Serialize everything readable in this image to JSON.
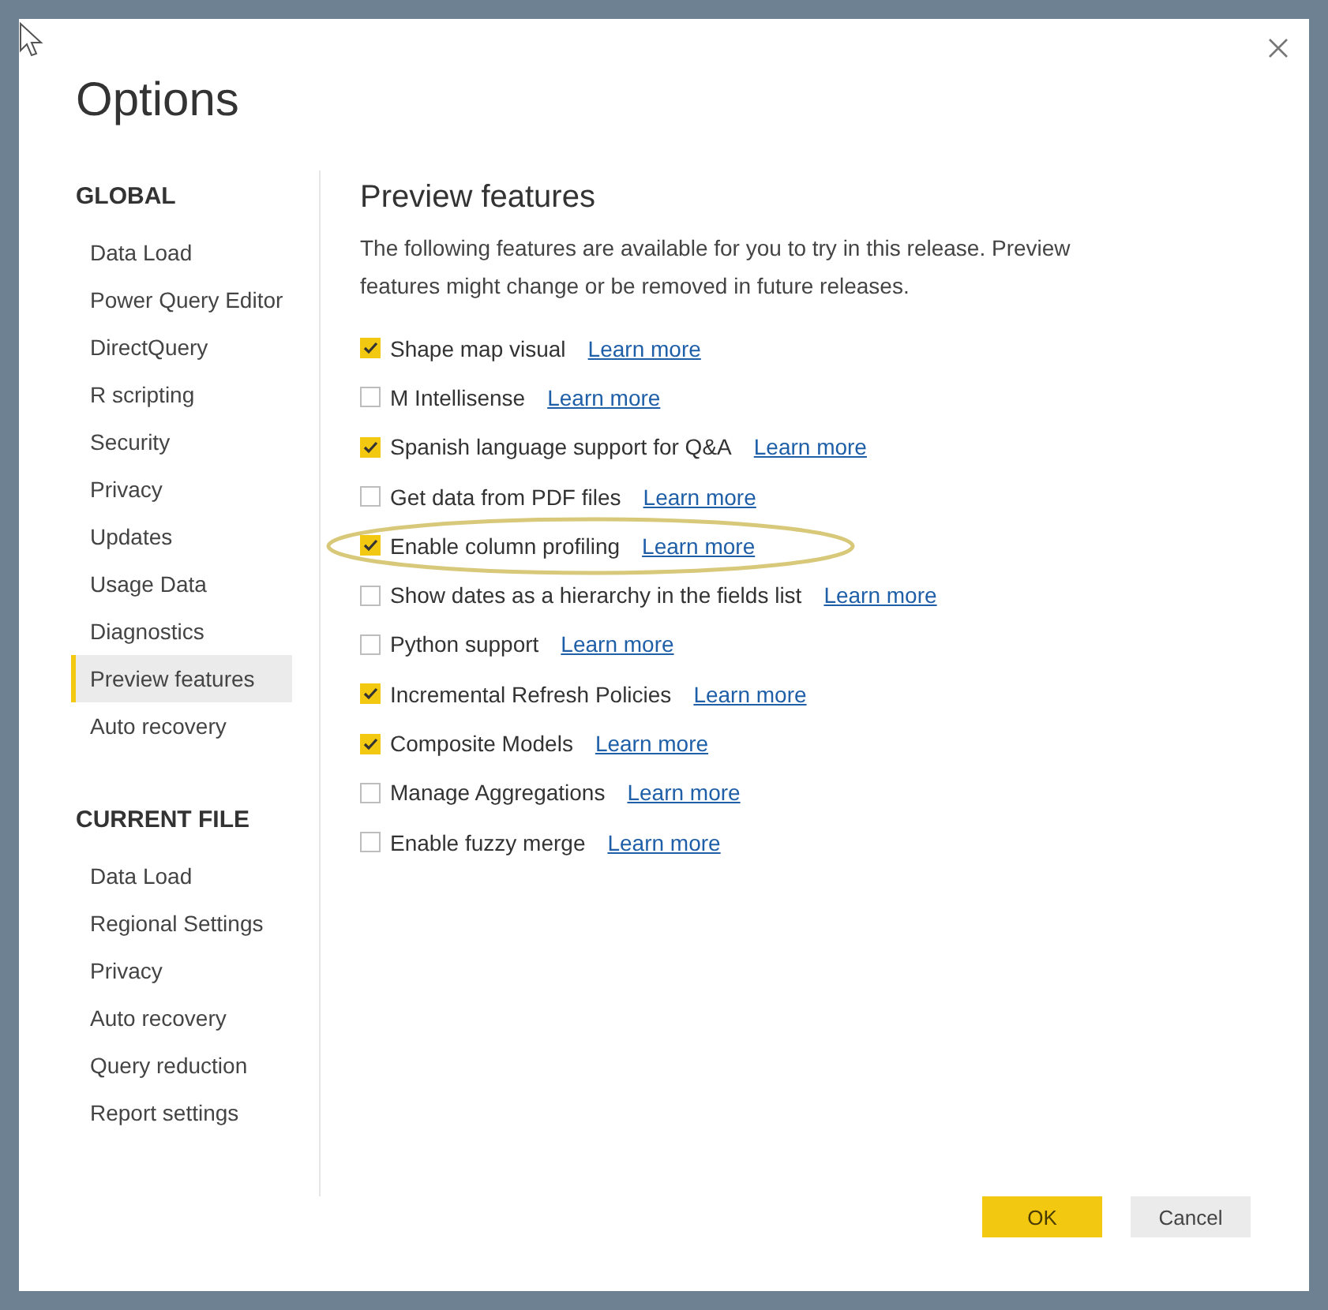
{
  "window": {
    "title": "Options"
  },
  "sidebar": {
    "sections": [
      {
        "heading": "GLOBAL",
        "items": [
          {
            "label": "Data Load",
            "selected": false
          },
          {
            "label": "Power Query Editor",
            "selected": false
          },
          {
            "label": "DirectQuery",
            "selected": false
          },
          {
            "label": "R scripting",
            "selected": false
          },
          {
            "label": "Security",
            "selected": false
          },
          {
            "label": "Privacy",
            "selected": false
          },
          {
            "label": "Updates",
            "selected": false
          },
          {
            "label": "Usage Data",
            "selected": false
          },
          {
            "label": "Diagnostics",
            "selected": false
          },
          {
            "label": "Preview features",
            "selected": true
          },
          {
            "label": "Auto recovery",
            "selected": false
          }
        ]
      },
      {
        "heading": "CURRENT FILE",
        "items": [
          {
            "label": "Data Load",
            "selected": false
          },
          {
            "label": "Regional Settings",
            "selected": false
          },
          {
            "label": "Privacy",
            "selected": false
          },
          {
            "label": "Auto recovery",
            "selected": false
          },
          {
            "label": "Query reduction",
            "selected": false
          },
          {
            "label": "Report settings",
            "selected": false
          }
        ]
      }
    ]
  },
  "content": {
    "heading": "Preview features",
    "description": "The following features are available for you to try in this release. Preview features might change or be removed in future releases.",
    "features": [
      {
        "label": "Shape map visual",
        "checked": true,
        "link": "Learn more",
        "circled": false
      },
      {
        "label": "M Intellisense",
        "checked": false,
        "link": "Learn more",
        "circled": false
      },
      {
        "label": "Spanish language support for Q&A",
        "checked": true,
        "link": "Learn more",
        "circled": false
      },
      {
        "label": "Get data from PDF files",
        "checked": false,
        "link": "Learn more",
        "circled": false
      },
      {
        "label": "Enable column profiling",
        "checked": true,
        "link": "Learn more",
        "circled": true
      },
      {
        "label": "Show dates as a hierarchy in the fields list",
        "checked": false,
        "link": "Learn more",
        "circled": false
      },
      {
        "label": "Python support",
        "checked": false,
        "link": "Learn more",
        "circled": false
      },
      {
        "label": "Incremental Refresh Policies",
        "checked": true,
        "link": "Learn more",
        "circled": false
      },
      {
        "label": "Composite Models",
        "checked": true,
        "link": "Learn more",
        "circled": false
      },
      {
        "label": "Manage Aggregations",
        "checked": false,
        "link": "Learn more",
        "circled": false
      },
      {
        "label": "Enable fuzzy merge",
        "checked": false,
        "link": "Learn more",
        "circled": false
      }
    ]
  },
  "buttons": [
    {
      "label": "OK",
      "kind": "primary"
    },
    {
      "label": "Cancel",
      "kind": "secondary"
    }
  ]
}
